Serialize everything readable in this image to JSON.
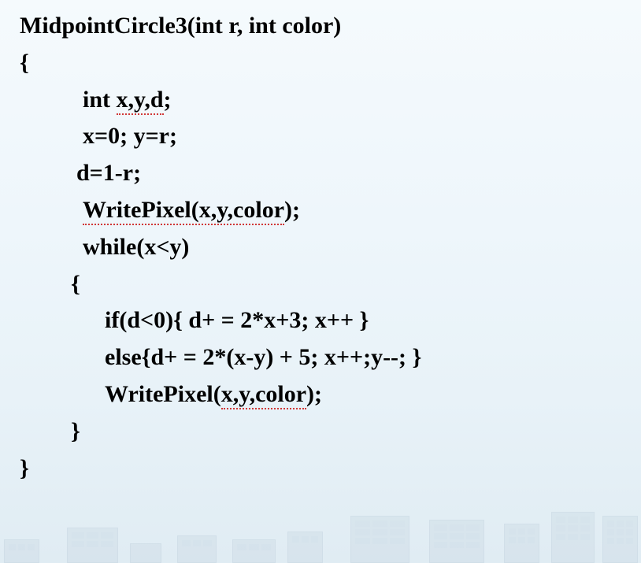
{
  "code": {
    "line1": "MidpointCircle3(int r, int color)",
    "line2": "{",
    "line3_pre": "int ",
    "line3_u": "x,y,d",
    "line3_post": ";",
    "line4": "x=0; y=r;",
    "line5": "d=1-r;",
    "line6_u": "WritePixel(x,y,color",
    "line6_post": ");",
    "line7": "while(x<y)",
    "line8": "{",
    "line9": "if(d<0){ d+ = 2*x+3; x++ }",
    "line10": "else{d+ = 2*(x-y) + 5; x++;y--; }",
    "line11_pre": "WritePixel(",
    "line11_u": "x,y,color",
    "line11_post": ");",
    "line12": "}",
    "line13": "}"
  }
}
